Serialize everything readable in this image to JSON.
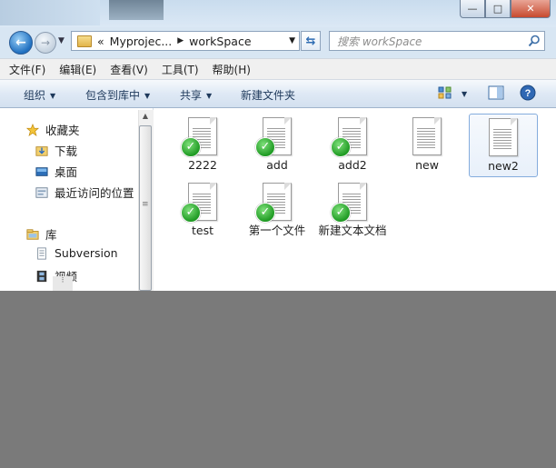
{
  "window": {
    "buttons": {
      "minimize": "—",
      "maximize": "□",
      "close": "✕"
    }
  },
  "nav": {
    "back_glyph": "←",
    "forward_glyph": "→",
    "address": {
      "overflow": "«",
      "crumbs": [
        "Myprojec...",
        "workSpace"
      ]
    },
    "search_placeholder": "搜索 workSpace"
  },
  "menu": [
    "文件(F)",
    "编辑(E)",
    "查看(V)",
    "工具(T)",
    "帮助(H)"
  ],
  "toolbar": {
    "organize": "组织",
    "include_library": "包含到库中",
    "share": "共享",
    "new_folder": "新建文件夹"
  },
  "sidebar": {
    "favorites": {
      "title": "收藏夹",
      "items": [
        "下载",
        "桌面",
        "最近访问的位置"
      ]
    },
    "libraries": {
      "title": "库",
      "items": [
        "Subversion",
        "视频"
      ]
    }
  },
  "files": [
    {
      "name": "2222",
      "svn_ok": true
    },
    {
      "name": "add",
      "svn_ok": true
    },
    {
      "name": "add2",
      "svn_ok": true
    },
    {
      "name": "new",
      "svn_ok": false
    },
    {
      "name": "new2",
      "svn_ok": false,
      "selected": true
    },
    {
      "name": "test",
      "svn_ok": true
    },
    {
      "name": "第一个文件",
      "svn_ok": true
    },
    {
      "name": "新建文本文档",
      "svn_ok": true
    }
  ],
  "colors": {
    "accent": "#1f6fc0",
    "svn_ok": "#1f9a23",
    "background": "#7a7a7a"
  }
}
